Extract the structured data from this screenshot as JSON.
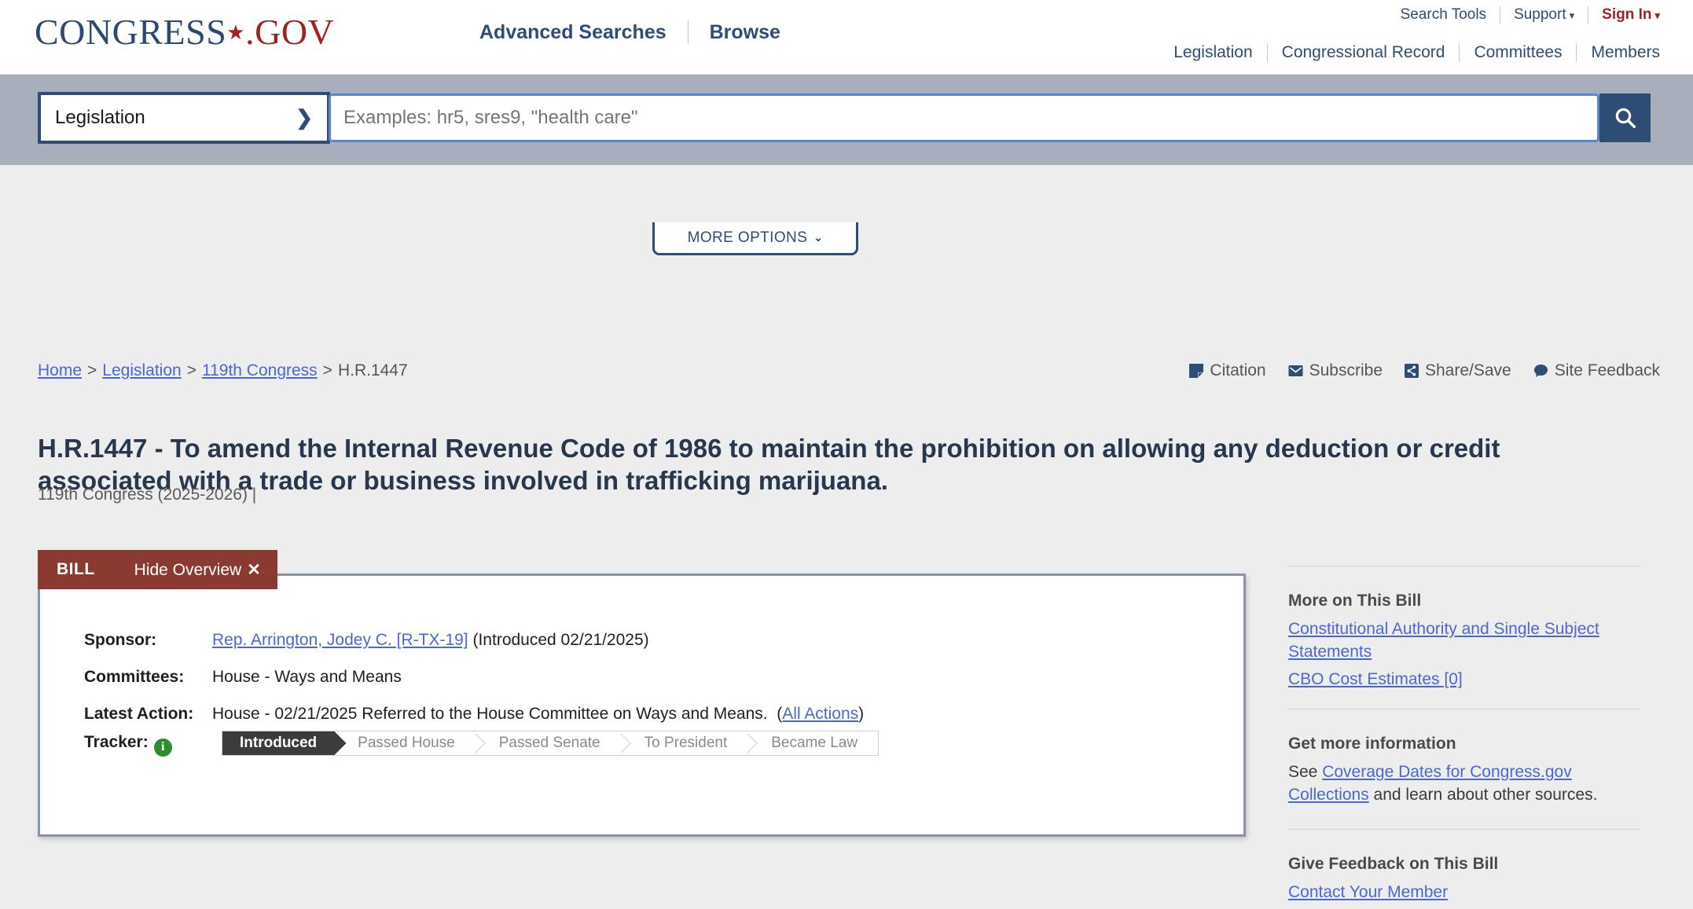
{
  "header": {
    "logo": {
      "part1": "CONGRESS",
      "star": "★",
      "part2": ".GOV"
    },
    "main_nav": [
      {
        "label": "Advanced Searches"
      },
      {
        "label": "Browse"
      }
    ],
    "util_nav": [
      {
        "label": "Search Tools"
      },
      {
        "label": "Support",
        "caret": "▾"
      },
      {
        "label": "Sign In",
        "caret": "▾"
      }
    ],
    "section_nav": [
      {
        "label": "Legislation"
      },
      {
        "label": "Congressional Record"
      },
      {
        "label": "Committees"
      },
      {
        "label": "Members"
      }
    ]
  },
  "search": {
    "scope_selected": "Legislation",
    "placeholder": "Examples: hr5, sres9, \"health care\"",
    "value": "",
    "more_options_label": "MORE OPTIONS",
    "more_options_caret": "⌄"
  },
  "breadcrumb": {
    "items": [
      {
        "label": "Home",
        "link": true
      },
      {
        "label": "Legislation",
        "link": true
      },
      {
        "label": "119th Congress",
        "link": true
      },
      {
        "label": "H.R.1447",
        "link": false
      }
    ],
    "separator": ">"
  },
  "page_utils": [
    {
      "label": "Citation",
      "icon": "citation-icon"
    },
    {
      "label": "Subscribe",
      "icon": "envelope-icon"
    },
    {
      "label": "Share/Save",
      "icon": "share-icon"
    },
    {
      "label": "Site Feedback",
      "icon": "comment-icon"
    }
  ],
  "bill": {
    "title": "H.R.1447 - To amend the Internal Revenue Code of 1986 to maintain the prohibition on allowing any deduction or credit associated with a trade or business involved in trafficking marijuana.",
    "congress_line": "119th Congress (2025-2026) |",
    "tab_label": "BILL",
    "hide_overview_label": "Hide Overview",
    "hide_overview_x": "✕",
    "overview": {
      "sponsor_key": "Sponsor:",
      "sponsor_link": "Rep. Arrington, Jodey C. [R-TX-19]",
      "sponsor_suffix": "(Introduced 02/21/2025)",
      "committees_key": "Committees:",
      "committees_value": "House - Ways and Means",
      "latest_action_key": "Latest Action:",
      "latest_action_value": "House - 02/21/2025 Referred to the House Committee on Ways and Means.",
      "latest_action_open_paren": "(",
      "latest_action_link": "All Actions",
      "latest_action_close_paren": ")",
      "tracker_key": "Tracker:",
      "tracker_info_icon": "i"
    },
    "tracker_steps": [
      {
        "label": "Introduced",
        "active": true
      },
      {
        "label": "Passed House",
        "active": false
      },
      {
        "label": "Passed Senate",
        "active": false
      },
      {
        "label": "To President",
        "active": false
      },
      {
        "label": "Became Law",
        "active": false
      }
    ]
  },
  "sidebar": {
    "more_on_bill": {
      "heading": "More on This Bill",
      "links": [
        "Constitutional Authority and Single Subject Statements",
        "CBO Cost Estimates [0]"
      ]
    },
    "get_more_info": {
      "heading": "Get more information",
      "prefix": "See ",
      "link": "Coverage Dates for Congress.gov Collections",
      "suffix": " and learn about other sources."
    },
    "give_feedback": {
      "heading": "Give Feedback on This Bill",
      "link": "Contact Your Member"
    }
  },
  "colors": {
    "brand_blue": "#2d4d75",
    "brand_red": "#9c2223",
    "bill_tab_red": "#8a3a30",
    "link_blue": "#4a67d8",
    "tracker_active": "#3c3c3c",
    "info_green": "#2e8b2e",
    "search_band": "#a8aebb",
    "page_bg": "#ededed"
  }
}
